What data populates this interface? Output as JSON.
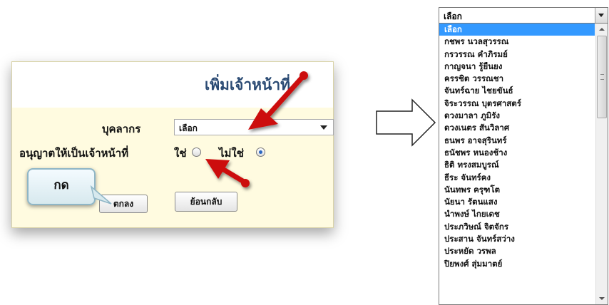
{
  "form": {
    "title": "เพิ่มเจ้าหน้าที่",
    "personnel_label": "บุคลากร",
    "personnel_value": "เลือก",
    "permission_label": "อนุญาตให้เป็นเจ้าหน้าที่",
    "option_yes": "ใช่",
    "option_no": "ไม่ใช่",
    "selected_option": "ไม่ใช่",
    "ok_button": "ตกลง",
    "back_button": "ย้อนกลับ"
  },
  "callout": {
    "text": "กด"
  },
  "dropdown": {
    "value": "เลือก",
    "items": [
      "เลือก",
      "กชพร นวลสุวรรณ",
      "กรวรรณ คำภิรมย์",
      "กาญจนา รู้ยืนยง",
      "ครรชิต วรรณชา",
      "จันทร์ฉาย ไชยขันธ์",
      "จิระวรรณ บุตรศาสตร์",
      "ดวงมาลา ภูมิรัง",
      "ดวงเนตร สันวิลาศ",
      "ธนพร อาจสุรินทร์",
      "ธนัชพร หนองช้าง",
      "ธิติ ทรงสมบูรณ์",
      "ธีระ จันทร์คง",
      "นันทพร ครุฑโต",
      "นัยนา รัตนแสง",
      "นำพงษ์ ไกยเดช",
      "ประภวิษณ์ จิตจักร",
      "ประสาน จันทร์สว่าง",
      "ประหยัด วรพล",
      "ปิยพงศ์ สุ่มมาตย์"
    ],
    "selected_index": 0
  },
  "colors": {
    "panel_bg": "#fffbe0",
    "title_color": "#2a4a73",
    "highlight": "#3399ff",
    "arrow_red": "#cc1111"
  }
}
